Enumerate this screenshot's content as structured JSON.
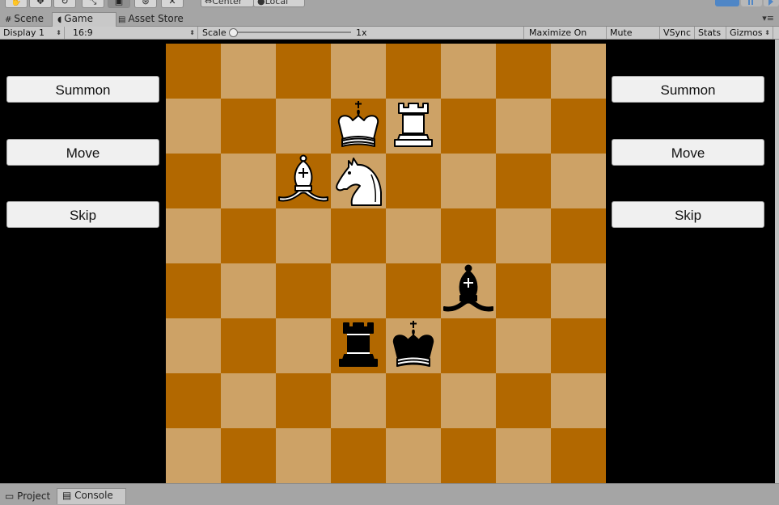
{
  "toolbar": {
    "pivot_label": "Center",
    "space_label": "Local"
  },
  "editor_tabs": [
    {
      "label": "Scene",
      "icon": "hash-icon"
    },
    {
      "label": "Game",
      "icon": "pacman-icon",
      "active": true
    },
    {
      "label": "Asset Store",
      "icon": "store-icon"
    }
  ],
  "game_bar": {
    "display": "Display 1",
    "aspect": "16:9",
    "scale_label": "Scale",
    "scale_value": "1x",
    "scale_fraction": 0.0,
    "maximize": "Maximize On Play",
    "mute": "Mute Audio",
    "vsync": "VSync",
    "stats": "Stats",
    "gizmos": "Gizmos"
  },
  "left_panel": {
    "summon": "Summon",
    "move": "Move",
    "skip": "Skip"
  },
  "right_panel": {
    "summon": "Summon",
    "move": "Move",
    "skip": "Skip"
  },
  "board": {
    "colors": {
      "dark": "#b26800",
      "light": "#cda266"
    },
    "pieces": [
      {
        "piece": "king",
        "color": "white",
        "row": 1,
        "col": 3
      },
      {
        "piece": "rook",
        "color": "white",
        "row": 1,
        "col": 4
      },
      {
        "piece": "bishop",
        "color": "white",
        "row": 2,
        "col": 2
      },
      {
        "piece": "knight",
        "color": "white",
        "row": 2,
        "col": 3
      },
      {
        "piece": "bishop",
        "color": "black",
        "row": 4,
        "col": 5
      },
      {
        "piece": "rook",
        "color": "black",
        "row": 5,
        "col": 3
      },
      {
        "piece": "king",
        "color": "black",
        "row": 5,
        "col": 4
      }
    ]
  },
  "bottom_tabs": [
    {
      "label": "Project",
      "icon": "folder-icon"
    },
    {
      "label": "Console",
      "icon": "console-icon",
      "active": true
    }
  ]
}
